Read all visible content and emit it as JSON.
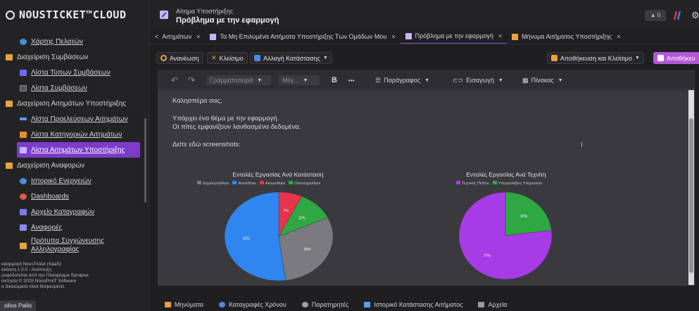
{
  "app": {
    "logo": "NOUSTICKET™CLOUD"
  },
  "sidebar": {
    "items": [
      {
        "label": "Χάρτης Πελατών",
        "icon": "map-icon",
        "color": "#4a8de0"
      },
      {
        "label": "Διαχείριση Συμβάσεων",
        "icon": "folder-icon",
        "color": "#e8a33a"
      },
      {
        "label": "Λίστα Τύπων Συμβάσεων",
        "icon": "list-icon",
        "color": "#6c6cf0"
      },
      {
        "label": "Λίστα Συμβάσεων",
        "icon": "document-icon",
        "color": "#8a8a90"
      },
      {
        "label": "Διαχείριση Αιτημάτων Υποστήριξης",
        "icon": "folder-icon",
        "color": "#e8a33a"
      },
      {
        "label": "Λίστα Προελεύσεων Αιτημάτων",
        "icon": "source-icon",
        "color": "#5aa0e8"
      },
      {
        "label": "Λίστα Κατηγοριών Αιτημάτων",
        "icon": "category-icon",
        "color": "#e88a3a"
      },
      {
        "label": "Λίστα Αιτημάτων Υποστήριξης",
        "icon": "ticket-icon",
        "color": "#c7b6ff"
      },
      {
        "label": "Διαχείριση Αναφορών",
        "icon": "folder-icon",
        "color": "#e8a33a"
      },
      {
        "label": "Ιστορικό Ενεργειών",
        "icon": "history-icon",
        "color": "#4a8de0"
      },
      {
        "label": "Dashboards",
        "icon": "dashboard-icon",
        "color": "#e05a4a"
      },
      {
        "label": "Αρχείο Καταγραφών",
        "icon": "log-icon",
        "color": "#7a7af0"
      },
      {
        "label": "Αναφορές",
        "icon": "report-icon",
        "color": "#8a8af5"
      },
      {
        "label": "Πρότυπα Συγχώνευσης Αλληλογραφίας",
        "icon": "template-icon",
        "color": "#e8a33a"
      }
    ],
    "footer": [
      "εφαρμογή NousTicket (SaaS)",
      "έκδοση 1.0.0 - Ανάπτυξη",
      "ροφοδοτείται από την Πλατφόρμα Synapse",
      "ιεκτησία © 2025 NousProIT Software",
      "α δικαιώματα είναι δεσμευμένα."
    ],
    "user": "silios Pallis"
  },
  "header": {
    "subtitle": "Αίτημα Υποστήριξης",
    "title": "Πρόβλημα με την εφαρμογή",
    "notification_count": "0",
    "gear": "⚙"
  },
  "tabs": {
    "back": "<",
    "items": [
      {
        "label": "Αιτημάτων",
        "icon": "",
        "color": ""
      },
      {
        "label": "Τα Μη Επιλυμένα Αιτήματα Υποστήριξης Των Ομάδων Μου",
        "icon": "ticket-icon",
        "color": "#c7b6ff"
      },
      {
        "label": "Πρόβλημα με την εφαρμογή",
        "icon": "ticket-icon",
        "color": "#c7b6ff"
      },
      {
        "label": "Μήνυμα Αιτήματος Υποστήριξης",
        "icon": "message-icon",
        "color": "#e8a33a"
      }
    ],
    "close": "×"
  },
  "toolbar": {
    "refresh": "Ανανέωση",
    "close": "Κλείσιμο",
    "change_status": "Αλλαγή Κατάστασης",
    "save_close": "Αποθήκευση και Κλείσιμο",
    "save": "Αποθήκευ"
  },
  "editor": {
    "undo": "↶",
    "redo": "↷",
    "font_placeholder": "Γραμματοσειρά",
    "size_placeholder": "Μέγ...",
    "bold": "B",
    "more": "•••",
    "paragraph": "Παράγραφος",
    "insert": "Εισαγωγή",
    "table": "Πίνακας",
    "lines": [
      "Καλησπέρα σας,",
      "Υπάρχει ένα θέμα με την εφαρμογή.",
      "Οι πίτες εμφανίζουν λανθασμένα δεδομένα.",
      "Δείτε εδώ screenshots:"
    ]
  },
  "chart_data": [
    {
      "type": "pie",
      "title": "Εντολές Εργασίας Ανά Κατάσταση",
      "categories": [
        "Δημιουργήθηκε",
        "Ανατέθηκε",
        "Ακυρώθηκε",
        "Ολοκληρώθηκε"
      ],
      "values": [
        30,
        52,
        7,
        11
      ],
      "labels": [
        "30%",
        "52%",
        "7%",
        "11%"
      ],
      "colors": [
        "#7b7b7f",
        "#2f86f0",
        "#e8344b",
        "#2fa844"
      ]
    },
    {
      "type": "pie",
      "title": "Εντολές Εργασίας Ανά Τεχνίτη",
      "categories": [
        "Τεχνικός Πεδίου",
        "Υπεργολάβος Υπηρεσιών"
      ],
      "values": [
        77,
        23
      ],
      "labels": [
        "77%",
        "23%"
      ],
      "colors": [
        "#a73be6",
        "#2fa844"
      ]
    }
  ],
  "bottom_tabs": [
    {
      "label": "Μηνύματα",
      "icon": "message-icon",
      "color": "#e8a33a"
    },
    {
      "label": "Καταγραφές Χρόνου",
      "icon": "clock-icon",
      "color": "#4a8de0"
    },
    {
      "label": "Παρατηρητές",
      "icon": "watcher-icon",
      "color": "#9aa0a8"
    },
    {
      "label": "Ιστορικό Κατάστασης Αιτήματος",
      "icon": "history-icon",
      "color": "#5aa0e8"
    },
    {
      "label": "Αρχεία",
      "icon": "file-icon",
      "color": "#9a9aa0"
    }
  ]
}
